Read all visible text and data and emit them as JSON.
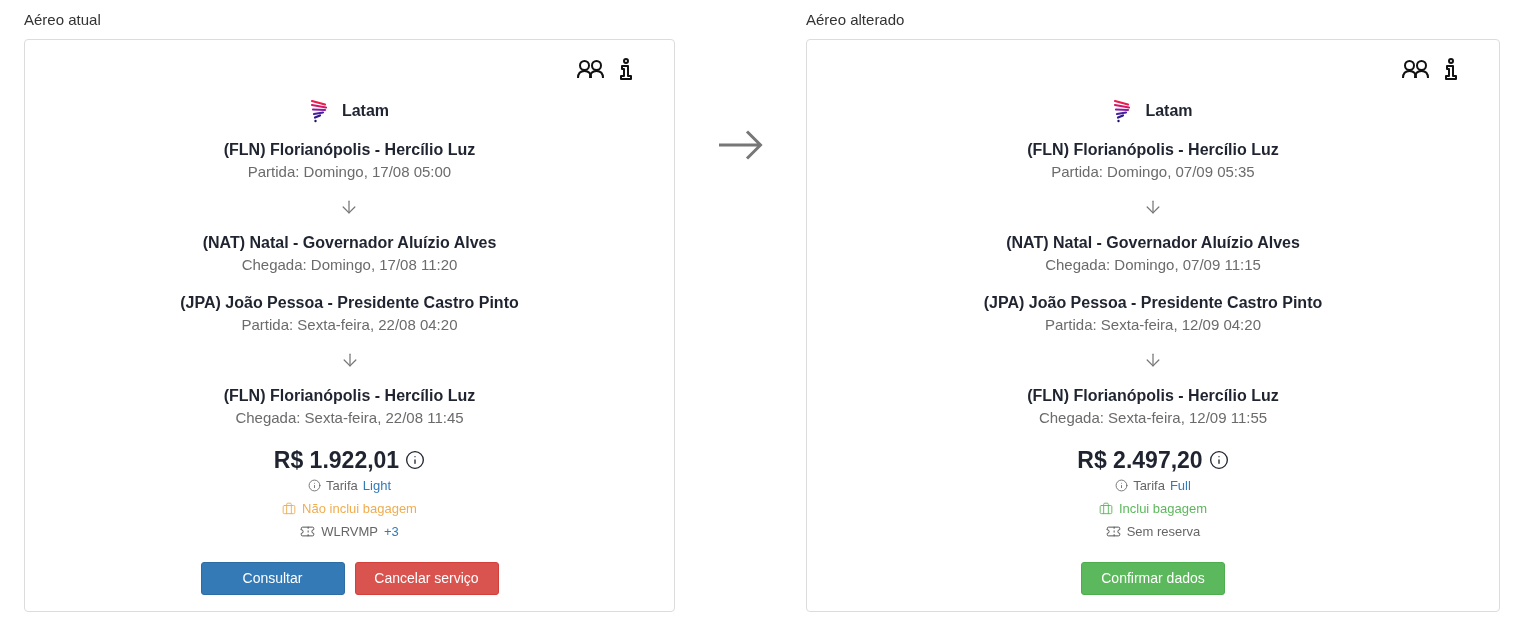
{
  "panels": [
    {
      "title": "Aéreo atual",
      "airline": "Latam",
      "segments": [
        {
          "origin": {
            "airport": "(FLN) Florianópolis - Hercílio Luz",
            "time": "Partida: Domingo, 17/08 05:00"
          },
          "destination": {
            "airport": "(NAT) Natal - Governador Aluízio Alves",
            "time": "Chegada: Domingo, 17/08 11:20"
          }
        },
        {
          "origin": {
            "airport": "(JPA) João Pessoa - Presidente Castro Pinto",
            "time": "Partida: Sexta-feira, 22/08 04:20"
          },
          "destination": {
            "airport": "(FLN) Florianópolis - Hercílio Luz",
            "time": "Chegada: Sexta-feira, 22/08 11:45"
          }
        }
      ],
      "price": "R$ 1.922,01",
      "fare": {
        "label": "Tarifa",
        "name": "Light"
      },
      "baggage": {
        "included": false,
        "text": "Não inclui bagagem"
      },
      "reservation": {
        "text": "WLRVMP",
        "extra": "+3"
      },
      "buttons": [
        {
          "label": "Consultar",
          "kind": "primary"
        },
        {
          "label": "Cancelar serviço",
          "kind": "danger"
        }
      ]
    },
    {
      "title": "Aéreo alterado",
      "airline": "Latam",
      "segments": [
        {
          "origin": {
            "airport": "(FLN) Florianópolis - Hercílio Luz",
            "time": "Partida: Domingo, 07/09 05:35"
          },
          "destination": {
            "airport": "(NAT) Natal - Governador Aluízio Alves",
            "time": "Chegada: Domingo, 07/09 11:15"
          }
        },
        {
          "origin": {
            "airport": "(JPA) João Pessoa - Presidente Castro Pinto",
            "time": "Partida: Sexta-feira, 12/09 04:20"
          },
          "destination": {
            "airport": "(FLN) Florianópolis - Hercílio Luz",
            "time": "Chegada: Sexta-feira, 12/09 11:55"
          }
        }
      ],
      "price": "R$ 2.497,20",
      "fare": {
        "label": "Tarifa",
        "name": "Full"
      },
      "baggage": {
        "included": true,
        "text": "Inclui bagagem"
      },
      "reservation": {
        "text": "Sem reserva"
      },
      "buttons": [
        {
          "label": "Confirmar dados",
          "kind": "success"
        }
      ]
    }
  ]
}
